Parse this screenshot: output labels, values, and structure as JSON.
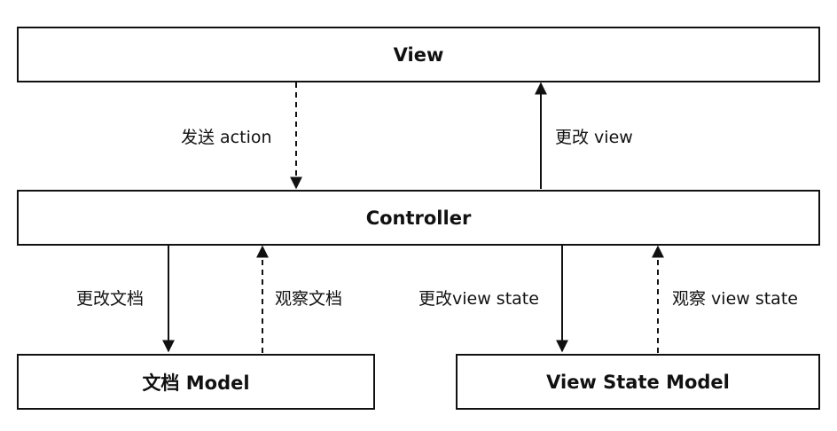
{
  "nodes": {
    "view": "View",
    "controller": "Controller",
    "doc_model": "文档 Model",
    "view_state_model": "View State Model"
  },
  "edges": {
    "send_action": "发送 action",
    "update_view": "更改 view",
    "update_doc": "更改文档",
    "observe_doc": "观察文档",
    "update_view_state": "更改view state",
    "observe_view_state": "观察 view state"
  },
  "colors": {
    "stroke": "#111111",
    "background": "#ffffff"
  }
}
